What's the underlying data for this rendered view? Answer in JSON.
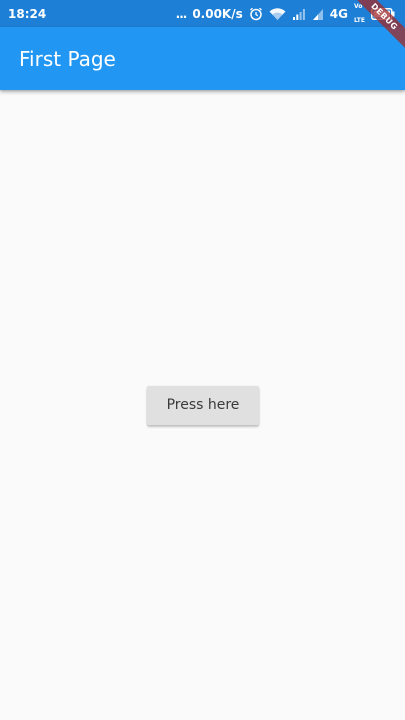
{
  "status_bar": {
    "time": "18:24",
    "dots": "...",
    "speed": "0.00K/s",
    "network": "4G",
    "volte_top": "Vo",
    "volte_bottom": "LTE",
    "icons": [
      "alarm-icon",
      "wifi-icon",
      "signal-icon",
      "signal-icon",
      "battery-icon"
    ]
  },
  "debug_banner": {
    "label": "DEBUG"
  },
  "app_bar": {
    "title": "First Page",
    "color": "#2196f3"
  },
  "main": {
    "button_label": "Press here"
  },
  "colors": {
    "status_bar": "#1e7fd6",
    "app_bar": "#2196f3",
    "background": "#fafafa",
    "button": "#e0e0e0",
    "debug_ribbon": "#a02828"
  }
}
